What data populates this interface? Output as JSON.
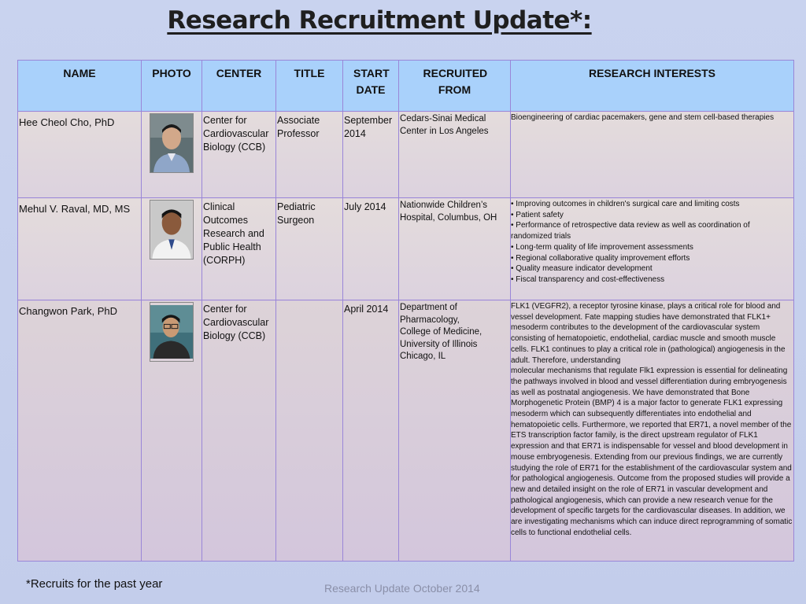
{
  "title": "Research Recruitment Update*:",
  "headers": {
    "name": "NAME",
    "photo": "PHOTO",
    "center": "CENTER",
    "title": "TITLE",
    "start_date": "START DATE",
    "recruited_from": "RECRUITED FROM",
    "research_interests": "RESEARCH INTERESTS"
  },
  "rows": [
    {
      "name": "Hee Cheol Cho, PhD",
      "center": "Center for Cardiovascular Biology (CCB)",
      "title": "Associate Professor",
      "start": "September 2014",
      "from": "Cedars-Sinai Medical Center in Los Angeles",
      "interests": "Bioengineering of cardiac pacemakers, gene and stem cell-based therapies"
    },
    {
      "name": "Mehul V. Raval, MD, MS",
      "center": "Clinical Outcomes Research and Public Health (CORPH)",
      "title": "Pediatric Surgeon",
      "start": "July 2014",
      "from": "Nationwide Children’s Hospital, Columbus, OH",
      "interests_list": [
        "• Improving outcomes in children's surgical care and limiting costs",
        "• Patient safety",
        "• Performance of retrospective data review as well as coordination of randomized trials",
        "• Long-term quality of life improvement assessments",
        "• Regional collaborative quality improvement efforts",
        "• Quality measure indicator development",
        "• Fiscal transparency and cost-effectiveness"
      ]
    },
    {
      "name": "Changwon Park, PhD",
      "center": "Center for Cardiovascular Biology (CCB)",
      "title": "",
      "start": "April 2014",
      "from_lines": [
        "Department of Pharmacology,",
        "College of Medicine,",
        "University of Illinois Chicago, IL"
      ],
      "interests_paragraphs": [
        "FLK1 (VEGFR2), a receptor tyrosine kinase, plays a critical role for blood and vessel development. Fate mapping studies have demonstrated that FLK1+ mesoderm contributes to the development of the cardiovascular system consisting of hematopoietic, endothelial, cardiac muscle and smooth muscle cells. FLK1 continues to play a critical role in (pathological) angiogenesis in the adult. Therefore, understanding",
        "molecular mechanisms that regulate Flk1 expression is essential for delineating the pathways involved in blood and vessel differentiation during embryogenesis as well as postnatal angiogenesis. We have demonstrated that Bone Morphogenetic Protein (BMP) 4 is a major factor to generate FLK1 expressing",
        "mesoderm which can subsequently differentiates into endothelial and hematopoietic cells. Furthermore, we reported that ER71, a novel member of the ETS transcription factor family, is the direct upstream regulator of FLK1 expression and that ER71 is indispensable for vessel and blood development in mouse embryogenesis. Extending from our previous findings, we are currently studying the role of ER71 for the establishment of the cardiovascular system and for pathological angiogenesis. Outcome from the proposed studies will provide a new and detailed insight on the role of ER71 in vascular development and pathological angiogenesis, which can provide a new research venue for the development of specific targets for the cardiovascular diseases. In addition, we are investigating mechanisms which can induce direct reprogramming of somatic cells to functional endothelial cells."
      ]
    }
  ],
  "footnote": "*Recruits for the past year",
  "footer": "Research Update October 2014",
  "colors": {
    "background": "#c9d3ef",
    "header_fill": "#a9d1fb",
    "border": "#9a86d8",
    "cell_fill": "#e4dcdc"
  }
}
